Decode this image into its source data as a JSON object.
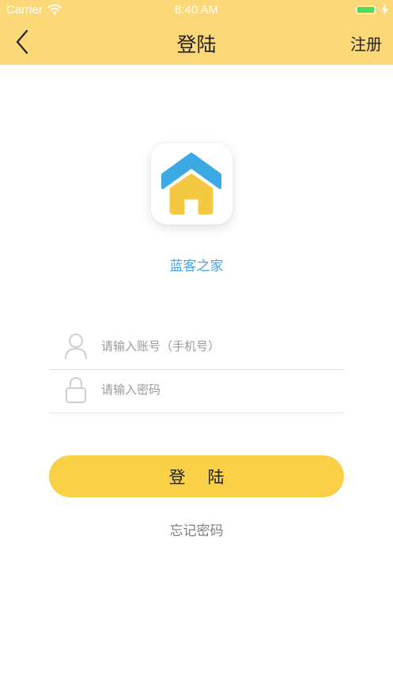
{
  "status_bar": {
    "carrier": "Carrier",
    "time": "8:40 AM"
  },
  "nav": {
    "title": "登陆",
    "register_label": "注册"
  },
  "brand": {
    "app_name": "蓝客之家"
  },
  "form": {
    "account_placeholder": "请输入账号（手机号）",
    "password_placeholder": "请输入密码",
    "login_label": "登陆",
    "forgot_label": "忘记密码"
  },
  "colors": {
    "header": "#fdd878",
    "accent": "#f9d046",
    "brand_text": "#4aa3e8",
    "logo_roof": "#3aa9e4",
    "logo_house": "#f5c842"
  },
  "icons": [
    "back-chevron-icon",
    "wifi-icon",
    "battery-icon",
    "charging-bolt-icon",
    "house-logo-icon",
    "user-icon",
    "lock-icon"
  ]
}
